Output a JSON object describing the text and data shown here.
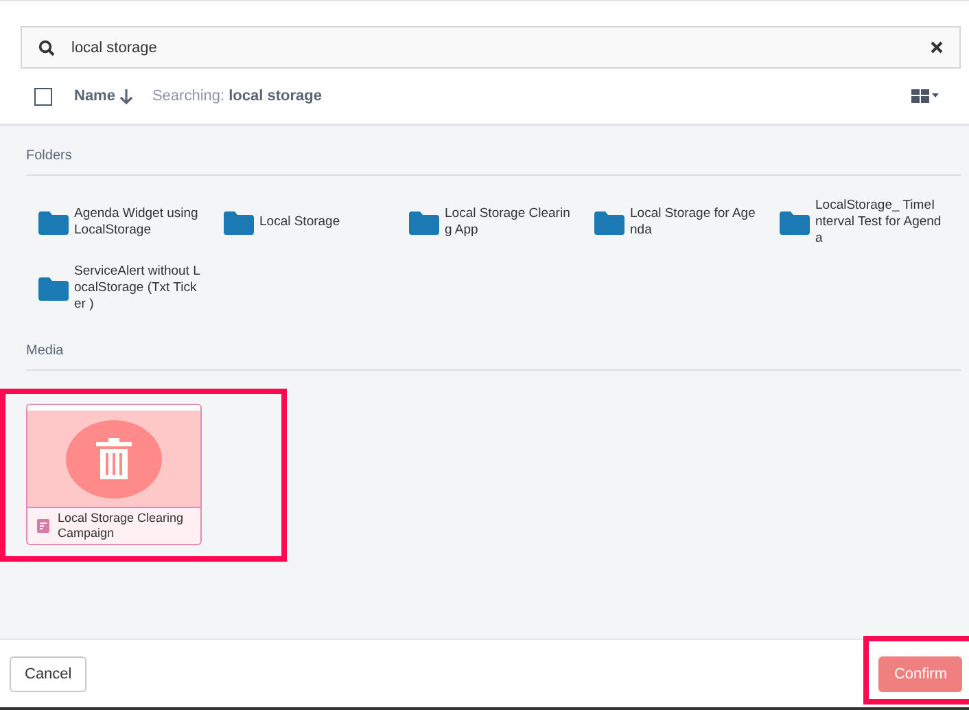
{
  "search": {
    "value": "local storage"
  },
  "toolbar": {
    "select_all_checked": false,
    "sort_label": "Name",
    "searching_label": "Searching:",
    "searching_term": "local storage"
  },
  "sections": [
    {
      "title": "Folders",
      "kind": "folders",
      "items": [
        {
          "name": "Agenda Widget using LocalStorage"
        },
        {
          "name": "Local Storage"
        },
        {
          "name": "Local Storage Clearing App"
        },
        {
          "name": "Local Storage for Agenda"
        },
        {
          "name": "LocalStorage_ TimeInterval Test for Agenda"
        },
        {
          "name": "ServiceAlert without LocalStorage (Txt Ticker )"
        }
      ]
    },
    {
      "title": "Media",
      "kind": "media",
      "items": [
        {
          "name": "Local Storage Clearing Campaign",
          "highlighted": true
        }
      ]
    }
  ],
  "footer": {
    "cancel": "Cancel",
    "confirm": {
      "label": "Confirm",
      "highlighted": true
    }
  }
}
